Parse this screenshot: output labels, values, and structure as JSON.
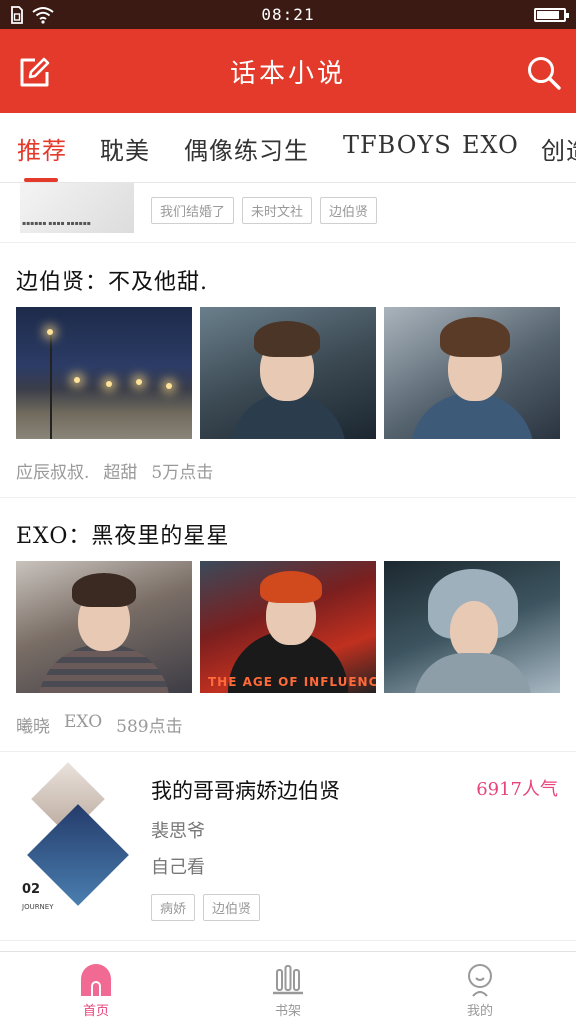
{
  "status_bar": {
    "time": "08:21",
    "battery_level": 0.85
  },
  "app_bar": {
    "title": "话本小说"
  },
  "tabs": [
    {
      "label": "推荐",
      "active": true
    },
    {
      "label": "耽美",
      "active": false
    },
    {
      "label": "偶像练习生",
      "active": false
    },
    {
      "label": "TFBOYS",
      "active": false
    },
    {
      "label": "EXO",
      "active": false
    },
    {
      "label": "创造",
      "active": false
    }
  ],
  "partial_item": {
    "tags": [
      "我们结婚了",
      "未时文社",
      "边伯贤"
    ]
  },
  "cards": [
    {
      "title": "边伯贤：不及他甜.",
      "meta": {
        "author": "应辰叔叔.",
        "tag": "超甜",
        "clicks": "5万点击"
      }
    },
    {
      "title": "EXO：黑夜里的星星",
      "meta": {
        "author": "曦晓",
        "tag": "EXO",
        "clicks": "589点击"
      },
      "image_overlay": "THE AGE OF INFLUENCE"
    }
  ],
  "novel": {
    "title": "我的哥哥病娇边伯贤",
    "popularity": "6917人气",
    "author": "裴思爷",
    "description": "自己看",
    "tags": [
      "病娇",
      "边伯贤"
    ],
    "cover_number": "02",
    "cover_sub": "JOURNEY"
  },
  "bottom_nav": [
    {
      "label": "首页",
      "icon": "home-icon",
      "active": true
    },
    {
      "label": "书架",
      "icon": "bookshelf-icon",
      "active": false
    },
    {
      "label": "我的",
      "icon": "profile-icon",
      "active": false
    }
  ],
  "colors": {
    "accent": "#e33a2b",
    "pink": "#e8447a",
    "status_bar": "#3b1a14"
  }
}
